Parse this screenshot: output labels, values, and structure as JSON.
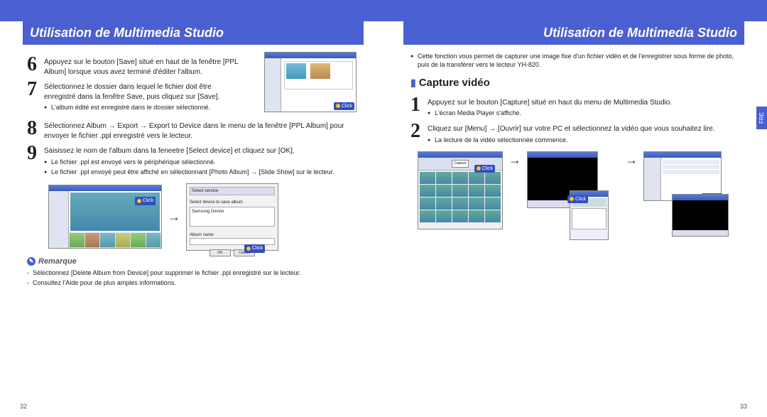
{
  "header": {
    "left_title": "Utilisation de Multimedia Studio",
    "right_title": "Utilisation de Multimedia Studio"
  },
  "lang_tab": "FRE",
  "page_numbers": {
    "left": "32",
    "right": "33"
  },
  "click_label": "Click",
  "left": {
    "step6": "Appuyez sur le bouton [Save] situé en haut de la fenêtre [PPL Album] lorsque vous avez terminé d'éditer l'album.",
    "step7": "Sélectionnez le dossier dans lequel le fichier doit être enregistré dans la fenêtre Save, puis cliquez sur [Save].",
    "step7_bullet": "L'album édité est enregistré dans le dossier sélectionné.",
    "step8": "Sélectionnez Album → Export → Export to Device dans le menu de la fenêtre [PPL Album] pour envoyer le fichier .ppl enregistré vers le lecteur.",
    "step9": "Saisissez le nom de l'album dans la feneetre [Select device] et cliquez sur [OK].",
    "step9_bullet1": "Le fichier .ppl est envoyé vers le périphérique sélectionné.",
    "step9_bullet2": "Le fichier .ppl envoyé peut être affiché en sélectionnant [Photo Album] → [Slide Show] sur le lecteur.",
    "dialog": {
      "title_text": "Select service",
      "subtitle": "Select device to save album",
      "list_item": "Samsung Device",
      "field_label": "Album name",
      "ok": "OK",
      "cancel": "Cancel"
    },
    "remark_label": "Remarque",
    "remark1": "Sélectionnez [Delete Album from Device] pour supprimer le fichier .ppl enregistré sur le lecteur.",
    "remark2": "Consultez l'Aide pour de plus amples informations."
  },
  "right": {
    "intro": "Cette fonction vous permet de capturer une image fixe d'un fichier vidéo et de l'enregistrer sous forme de photo, puis de la transférer vers le lecteur YH-820.",
    "section_title": "Capture vidéo",
    "step1": "Appuyez sur le bouton [Capture] situé en haut du menu de Multimedia Studio.",
    "step1_bullet": "L'écran Media Player s'affiche.",
    "step2": "Cliquez sur [Menu] → [Ouvrir] sur votre PC et sélectionnez la vidéo que vous souhaitez lire.",
    "step2_bullet": "La lecture de la vidéo sélectionnée commence.",
    "capture_btn": "Capture"
  }
}
